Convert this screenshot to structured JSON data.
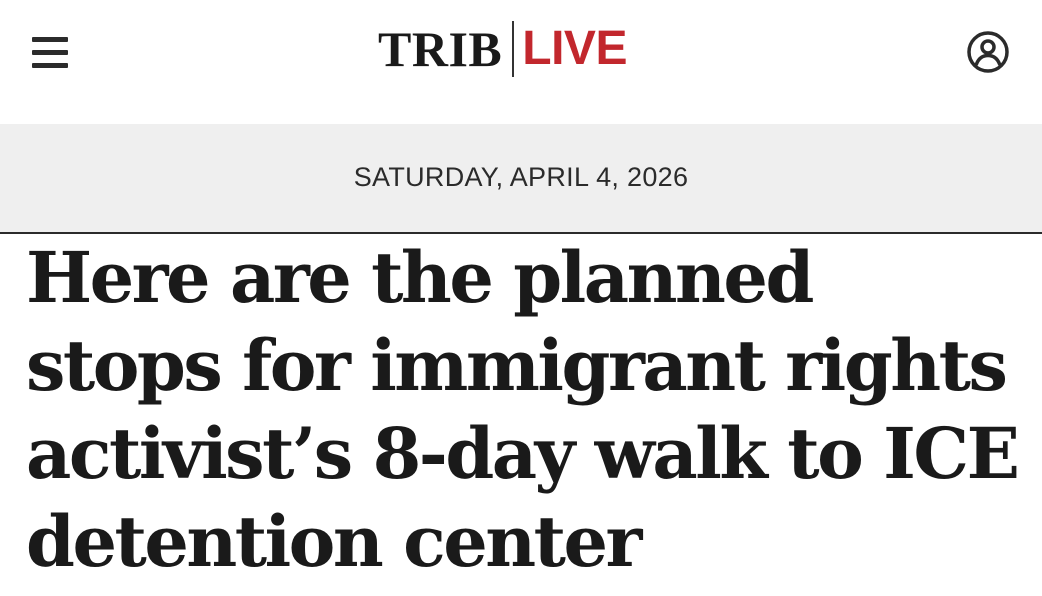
{
  "header": {
    "menu_icon": "hamburger-menu-icon",
    "logo": {
      "trib": "TRIB",
      "live": "LIVE",
      "live_color": "#c2272d"
    },
    "account_icon": "user-account-icon"
  },
  "date_bar": {
    "date": "SATURDAY, APRIL 4, 2026"
  },
  "article": {
    "headline": "Here are the planned stops for immigrant rights activist’s 8-day walk to ICE detention center"
  }
}
